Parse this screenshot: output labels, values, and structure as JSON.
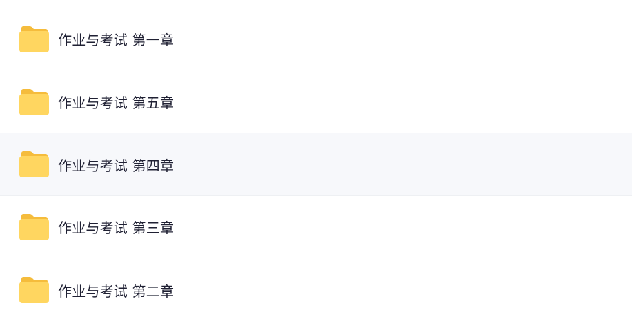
{
  "folders": [
    {
      "name": "作业与考试 第一章",
      "icon": "folder-icon"
    },
    {
      "name": "作业与考试 第五章",
      "icon": "folder-icon"
    },
    {
      "name": "作业与考试 第四章",
      "icon": "folder-icon"
    },
    {
      "name": "作业与考试 第三章",
      "icon": "folder-icon"
    },
    {
      "name": "作业与考试 第二章",
      "icon": "folder-icon"
    }
  ],
  "colors": {
    "folder_back": "#F5BC3C",
    "folder_front": "#FFD660",
    "text": "#1F2033",
    "hover_bg": "#F7F8FB",
    "divider": "#EEF0F3"
  }
}
